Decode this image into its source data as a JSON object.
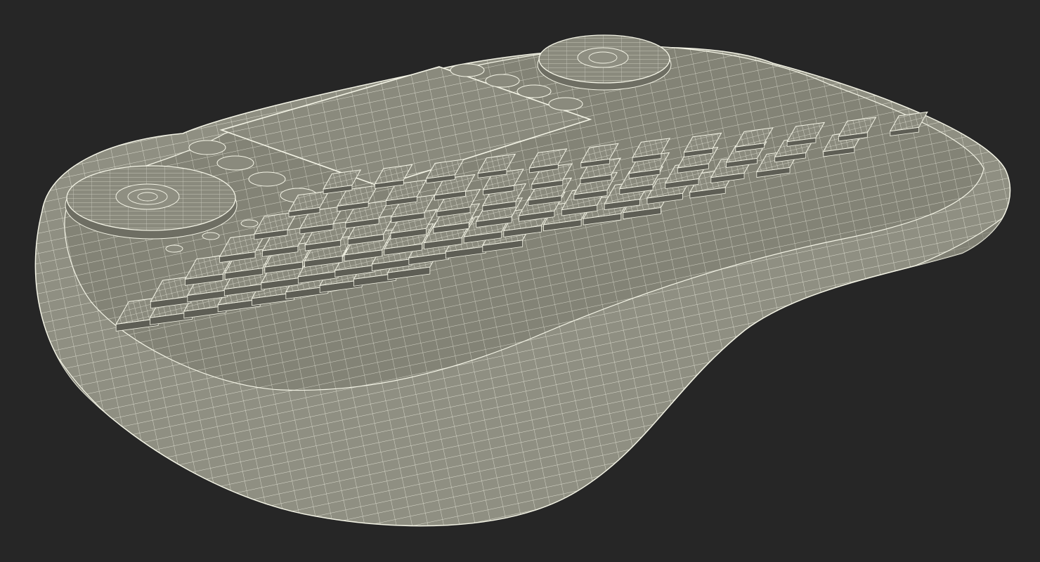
{
  "scene": {
    "background_color": "#262626",
    "subject": "wireframe-render",
    "colors": {
      "body_fill": "#8f8f82",
      "body_shadow": "#6e6e63",
      "surface_fill": "#838376",
      "key_top": "#8a8a7d",
      "key_side": "#5e5e55",
      "wire": "#f4f4e6"
    }
  }
}
